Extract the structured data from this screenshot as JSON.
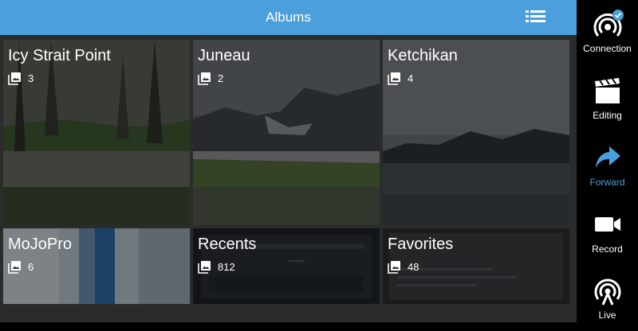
{
  "header": {
    "title": "Albums",
    "list_icon": "list-icon"
  },
  "albums": [
    {
      "name": "Icy Strait Point",
      "count": "3"
    },
    {
      "name": "Juneau",
      "count": "2"
    },
    {
      "name": "Ketchikan",
      "count": "4"
    },
    {
      "name": "MoJoPro",
      "count": "6"
    },
    {
      "name": "Recents",
      "count": "812"
    },
    {
      "name": "Favorites",
      "count": "48"
    }
  ],
  "sidebar": {
    "items": [
      {
        "label": "Connection",
        "icon": "broadcast-connected-icon",
        "active": false
      },
      {
        "label": "Editing",
        "icon": "clapperboard-icon",
        "active": false
      },
      {
        "label": "Forward",
        "icon": "forward-arrow-icon",
        "active": true
      },
      {
        "label": "Record",
        "icon": "video-camera-icon",
        "active": false
      },
      {
        "label": "Live",
        "icon": "antenna-icon",
        "active": false
      }
    ]
  },
  "colors": {
    "accent": "#4a9fdc",
    "background": "#000000",
    "grid_background": "#2b2b2b",
    "text": "#ffffff"
  }
}
